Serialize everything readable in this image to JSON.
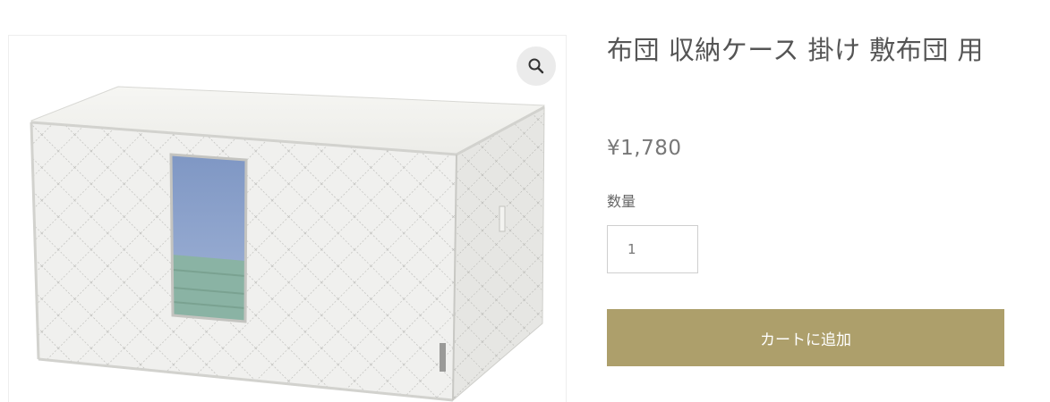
{
  "product": {
    "title": "布団 収納ケース 掛け 敷布団 用",
    "price": "¥1,780",
    "quantity_label": "数量",
    "quantity_value": "1",
    "add_to_cart_label": "カートに追加"
  },
  "gallery": {
    "zoom_icon": "magnifier-icon",
    "image_alt": "布団 収納ケース 掛け 敷布団 用"
  },
  "colors": {
    "button_background": "#ad9f6b",
    "title_text": "#555555",
    "price_text": "#777777"
  }
}
